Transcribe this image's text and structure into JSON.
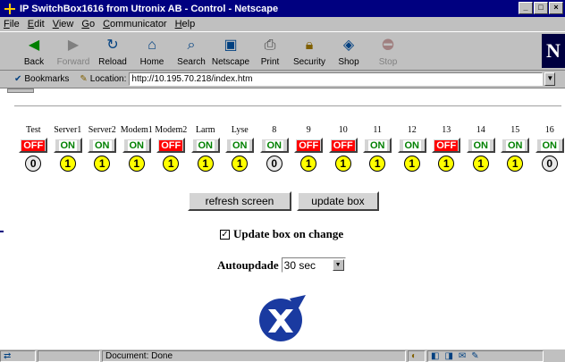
{
  "window": {
    "title": "IP SwitchBox1616 from Utronix AB - Control - Netscape",
    "buttons": [
      "_",
      "□",
      "×"
    ]
  },
  "menu": [
    "File",
    "Edit",
    "View",
    "Go",
    "Communicator",
    "Help"
  ],
  "toolbar": {
    "buttons": [
      {
        "label": "Back",
        "icon": "back-arrow-icon",
        "disabled": false
      },
      {
        "label": "Forward",
        "icon": "forward-arrow-icon",
        "disabled": true
      },
      {
        "label": "Reload",
        "icon": "reload-icon",
        "disabled": false
      },
      {
        "label": "Home",
        "icon": "home-icon",
        "disabled": false
      },
      {
        "label": "Search",
        "icon": "search-icon",
        "disabled": false
      },
      {
        "label": "Netscape",
        "icon": "netscape-icon",
        "disabled": false
      },
      {
        "label": "Print",
        "icon": "print-icon",
        "disabled": false
      },
      {
        "label": "Security",
        "icon": "lock-icon",
        "disabled": false
      },
      {
        "label": "Shop",
        "icon": "shop-icon",
        "disabled": false
      },
      {
        "label": "Stop",
        "icon": "stop-icon",
        "disabled": true
      }
    ],
    "logo_letter": "N"
  },
  "location_bar": {
    "bookmarks_label": "Bookmarks",
    "location_label": "Location:",
    "url": "http://10.195.70.218/index.htm"
  },
  "switches": [
    {
      "name": "Test",
      "state": "OFF",
      "status": "0"
    },
    {
      "name": "Server1",
      "state": "ON",
      "status": "1"
    },
    {
      "name": "Server2",
      "state": "ON",
      "status": "1"
    },
    {
      "name": "Modem1",
      "state": "ON",
      "status": "1"
    },
    {
      "name": "Modem2",
      "state": "OFF",
      "status": "1"
    },
    {
      "name": "Larm",
      "state": "ON",
      "status": "1"
    },
    {
      "name": "Lyse",
      "state": "ON",
      "status": "1"
    },
    {
      "name": "8",
      "state": "ON",
      "status": "0"
    },
    {
      "name": "9",
      "state": "OFF",
      "status": "1"
    },
    {
      "name": "10",
      "state": "OFF",
      "status": "1"
    },
    {
      "name": "11",
      "state": "ON",
      "status": "1"
    },
    {
      "name": "12",
      "state": "ON",
      "status": "1"
    },
    {
      "name": "13",
      "state": "OFF",
      "status": "1"
    },
    {
      "name": "14",
      "state": "ON",
      "status": "1"
    },
    {
      "name": "15",
      "state": "ON",
      "status": "1"
    },
    {
      "name": "16",
      "state": "ON",
      "status": "0"
    }
  ],
  "actions": {
    "refresh_label": "refresh screen",
    "update_label": "update box"
  },
  "options": {
    "update_on_change_label": "Update box on change",
    "update_on_change_checked": true,
    "autoupdate_label": "Autoupdade",
    "autoupdate_value": "30 sec"
  },
  "status_bar": {
    "message": "Document: Done"
  },
  "colors": {
    "on_text": "#008000",
    "off_bg": "#ff0000",
    "status_active": "#ffff00",
    "titlebar": "#000080"
  }
}
